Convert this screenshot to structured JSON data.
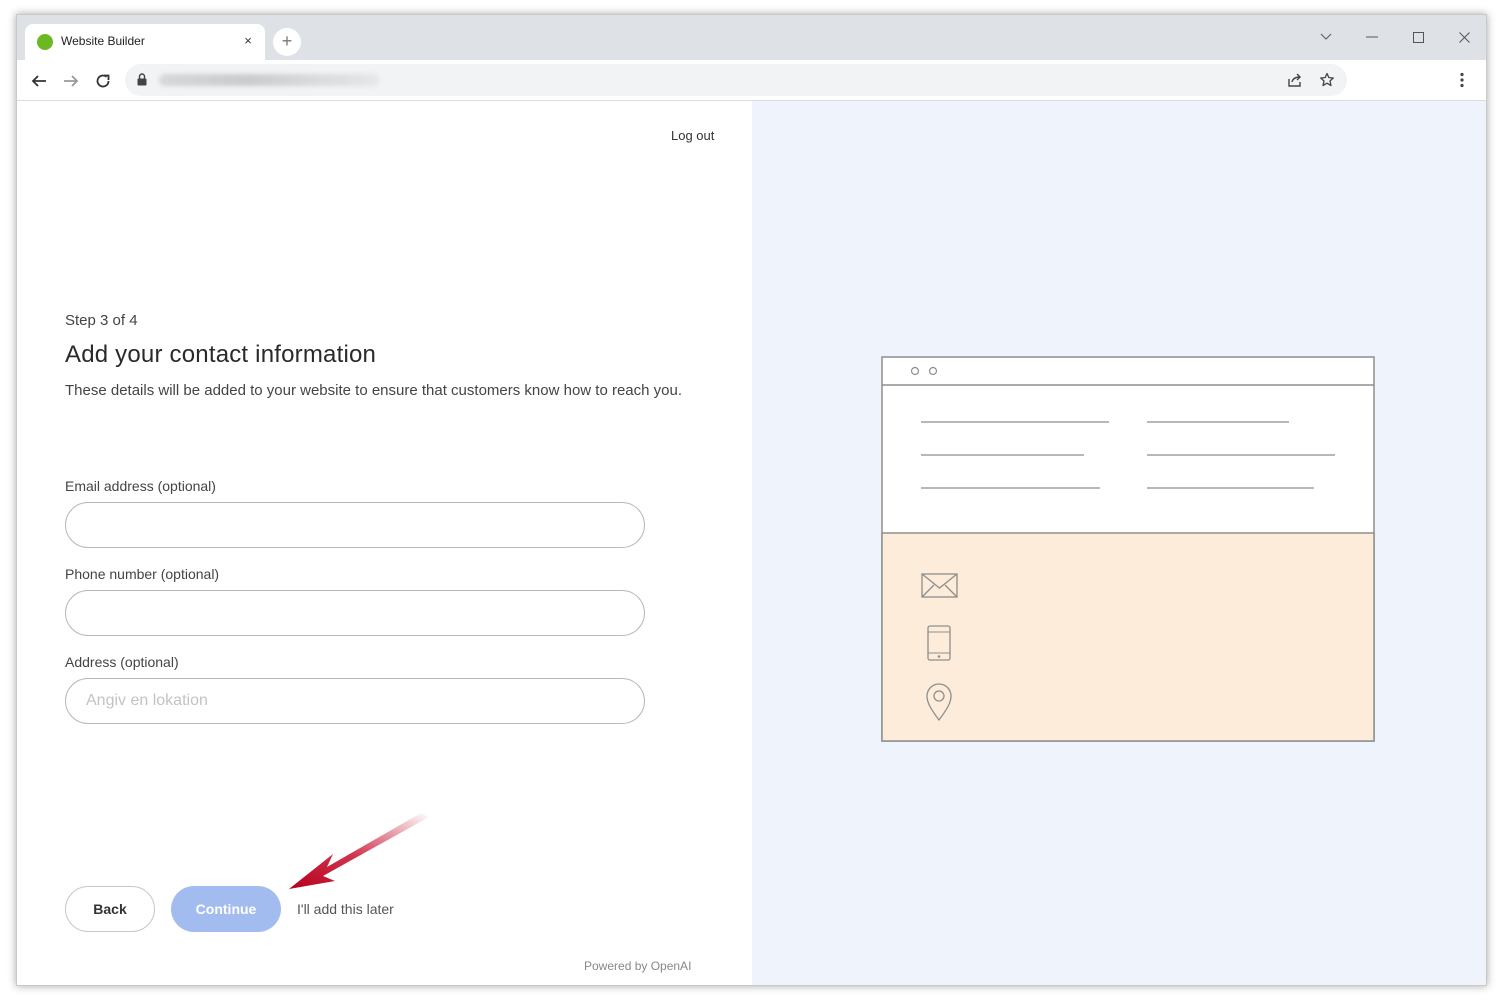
{
  "browser": {
    "tab_title": "Website Builder",
    "tab_close_glyph": "×",
    "new_tab_glyph": "+",
    "favicon_color": "#6cb822"
  },
  "page": {
    "logout_label": "Log out",
    "step_label": "Step 3 of 4",
    "title": "Add your contact information",
    "description": "These details will be added to your website to ensure that customers know how to reach you.",
    "form": {
      "email": {
        "label": "Email address (optional)",
        "value": "",
        "placeholder": ""
      },
      "phone": {
        "label": "Phone number (optional)",
        "value": "",
        "placeholder": ""
      },
      "address": {
        "label": "Address (optional)",
        "value": "",
        "placeholder": "Angiv en lokation"
      }
    },
    "buttons": {
      "back": "Back",
      "continue": "Continue",
      "skip": "I'll add this later"
    },
    "footer": "Powered by OpenAI"
  },
  "colors": {
    "accent_button": "#a3bcf0",
    "right_panel_bg": "#eff3fb",
    "illustration_contact_bg": "#fdecd9",
    "arrow": "#c8102e"
  },
  "icons": [
    "back-arrow-icon",
    "forward-arrow-icon",
    "reload-icon",
    "lock-icon",
    "share-icon",
    "star-icon",
    "kebab-menu-icon",
    "envelope-icon",
    "phone-icon",
    "location-pin-icon"
  ]
}
